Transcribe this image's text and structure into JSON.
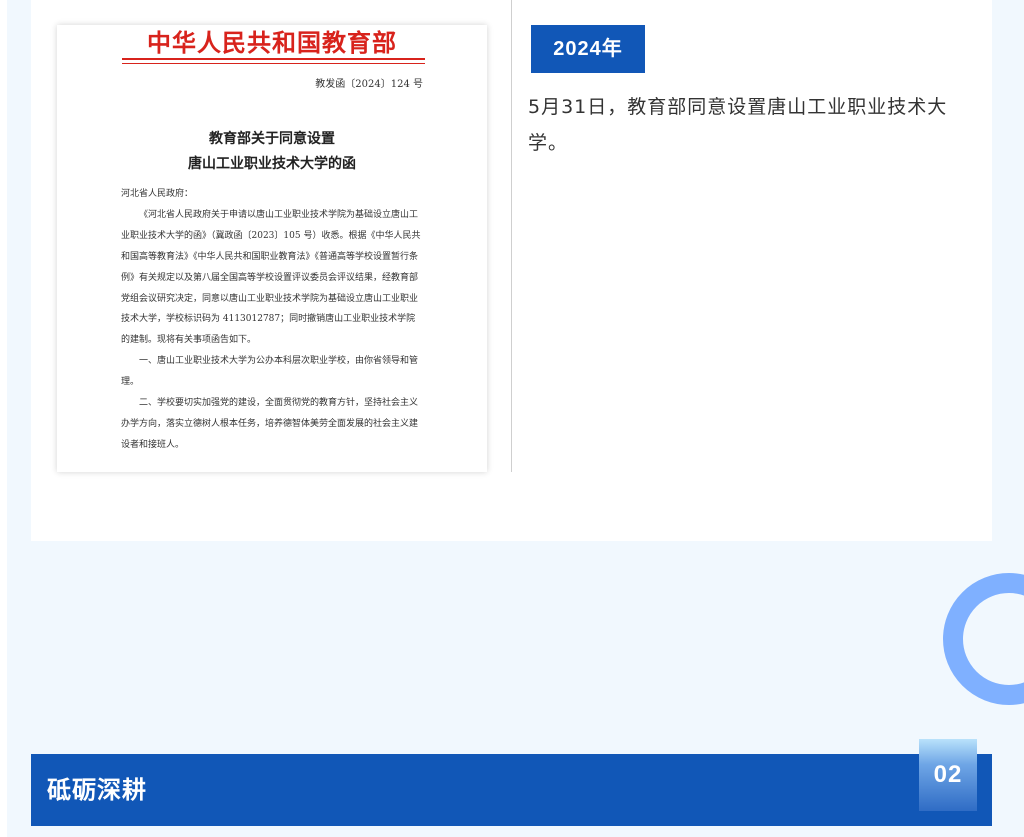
{
  "document": {
    "header": "中华人民共和国教育部",
    "number": "教发函〔2024〕124 号",
    "title_line1": "教育部关于同意设置",
    "title_line2": "唐山工业职业技术大学的函",
    "salutation": "河北省人民政府：",
    "paragraph1": "《河北省人民政府关于申请以唐山工业职业技术学院为基础设立唐山工业职业技术大学的函》（冀政函〔2023〕105 号）收悉。根据《中华人民共和国高等教育法》《中华人民共和国职业教育法》《普通高等学校设置暂行条例》有关规定以及第八届全国高等学校设置评议委员会评议结果，经教育部党组会议研究决定，同意以唐山工业职业技术学院为基础设立唐山工业职业技术大学，学校标识码为 4113012787；同时撤销唐山工业职业技术学院的建制。现将有关事项函告如下。",
    "paragraph2": "一、唐山工业职业技术大学为公办本科层次职业学校，由你省领导和管理。",
    "paragraph3": "二、学校要切实加强党的建设，全面贯彻党的教育方针，坚持社会主义办学方向，落实立德树人根本任务，培养德智体美劳全面发展的社会主义建设者和接班人。"
  },
  "timeline": {
    "year": "2024年",
    "event": "5月31日，教育部同意设置唐山工业职业技术大学。"
  },
  "section": {
    "title": "砥砺深耕",
    "number": "02"
  },
  "colors": {
    "accent": "#1157b7",
    "ring": "#7fb0ff",
    "background": "#f1f8fe",
    "seal_red": "#d8231c"
  }
}
